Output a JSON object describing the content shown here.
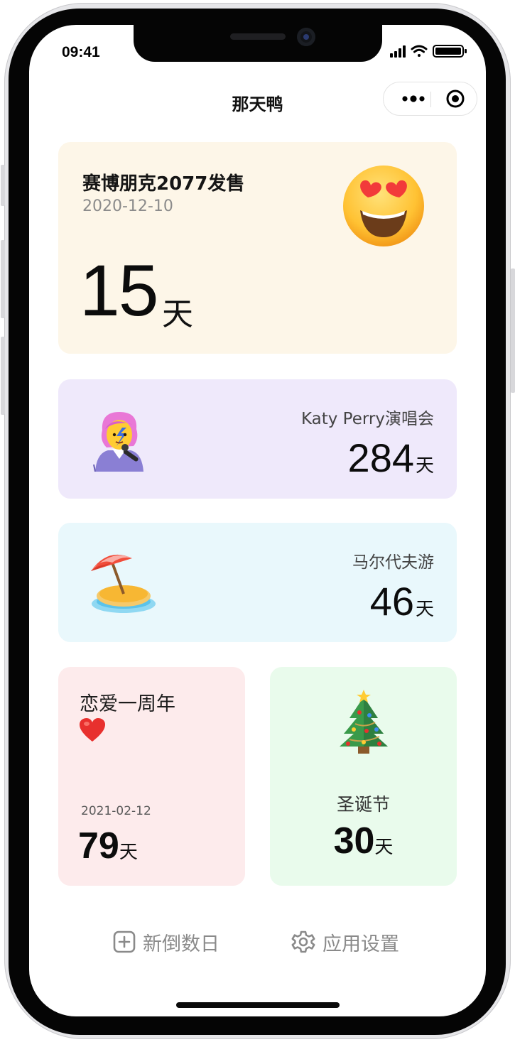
{
  "status": {
    "time": "09:41"
  },
  "nav": {
    "title": "那天鸭"
  },
  "cards": [
    {
      "title": "赛博朋克2077发售",
      "date": "2020-12-10",
      "count": "15",
      "unit": "天",
      "icon": "heart-eyes-face-emoji",
      "bg": "#fdf6e8"
    },
    {
      "title": "Katy Perry演唱会",
      "count": "284",
      "unit": "天",
      "icon": "singer-woman-emoji",
      "bg": "#efe9fb"
    },
    {
      "title": "马尔代夫游",
      "count": "46",
      "unit": "天",
      "icon": "beach-umbrella-island-emoji",
      "bg": "#e9f8fc"
    },
    {
      "title": "恋爱一周年",
      "date": "2021-02-12",
      "count": "79",
      "unit": "天",
      "icon": "red-heart-emoji",
      "bg": "#fdebec"
    },
    {
      "title": "圣诞节",
      "count": "30",
      "unit": "天",
      "icon": "christmas-tree-emoji",
      "bg": "#e9fbec"
    }
  ],
  "actions": {
    "new_label": "新倒数日",
    "settings_label": "应用设置"
  }
}
